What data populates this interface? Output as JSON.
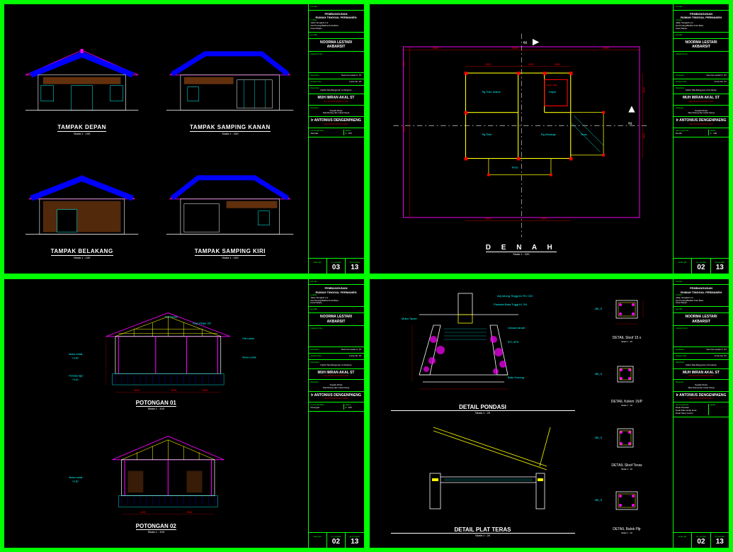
{
  "project": {
    "title_line1": "PEMBANGUNAN",
    "title_line2": "RUMAH TINGGAL PERMANEN",
    "location_label": "Lokasi :",
    "location_1": "Jalan Sungkuh Lor",
    "location_2": "Kel Purangi/Badha Kota Bara",
    "location_3": "Kota Palopo",
    "owner_label": "pemilik",
    "owner_name": "NOORMA LESTARI AKBARSIT",
    "note_label": "catatan/nota :"
  },
  "titleblock": {
    "arsitektur_label": "arsitektur",
    "arsitektur_val": "Noorma Lestari A. ST",
    "drafter_label": "drafterCAD",
    "drafter_val": "Imran Ak. ST",
    "diperiksa_label": "diperiksa",
    "kabid": "Kabid Tata Bangunan & Perijinan",
    "approver_name": "MUH IMRAN AKAL ST",
    "approver_nip": "Nip 19 XXX XXXXX 1 015",
    "disetujui": "disetujui",
    "kepala_dinas": "Kepala Dinas",
    "dinas": "Tata Ruang dan Cipta Karya",
    "kadis_name": "Ir ANTONIUS DENGENPAENG",
    "kadis_nip": "Nip XXXX XXXXX 1 018",
    "nama_gambar": "nama gambar :",
    "skala": "skala :",
    "kode_gbr": "kode gbr",
    "no_lembar": "no. lembar",
    "jml_lembar": "jml lembar",
    "total_sheets": "13"
  },
  "sheet1": {
    "views": [
      {
        "label": "TAMPAK DEPAN",
        "scale": "Skala 1 : 100"
      },
      {
        "label": "TAMPAK SAMPING KANAN",
        "scale": "Skala 1 : 100"
      },
      {
        "label": "TAMPAK BELAKANG",
        "scale": "Skala 1 : 100"
      },
      {
        "label": "TAMPAK SAMPING KIRI",
        "scale": "Skala 1 : 100"
      }
    ],
    "drawing_name": "Tampak",
    "scale": "1 : 100",
    "sheet_no": "03"
  },
  "sheet2": {
    "title": "D E N A H",
    "scale": "Skala 1 : 100",
    "section_marks": {
      "a": "01",
      "b": "02"
    },
    "rooms": [
      "Rg.Tidur Utama",
      "Rg.Keluarga",
      "Rg.Tidur",
      "Teras",
      "Teras",
      "Teras",
      "Dapur",
      "KMC IWC"
    ],
    "drawing_name": "Denah",
    "scale_tb": "1 : 100",
    "sheet_no": "02"
  },
  "sheet3": {
    "views": [
      {
        "label": "POTONGAN 01",
        "scale": "Skala 1 : 100"
      },
      {
        "label": "POTONGAN 02",
        "scale": "Skala 1 : 100"
      }
    ],
    "annotations": [
      "Puit Gantar",
      "Kayu Ringer 2/8",
      "Peil Lantai",
      "Muka Lantai +0.30",
      "Pondasi lajur +0.00",
      "Kuda-kuda",
      "Kusen 105 + 5/6 ant"
    ],
    "drawing_name": "Potongan",
    "scale": "1 : 100",
    "sheet_no": "02"
  },
  "sheet4": {
    "main_details": [
      {
        "label": "DETAIL PONDASI",
        "scale": "Skala 1 : 20"
      },
      {
        "label": "DETAIL PLAT TERAS",
        "scale": "Skala 1 : 20"
      }
    ],
    "side_details": [
      {
        "label": "DETAIL Sloof 15 x",
        "scale": "Skala 1 : 10"
      },
      {
        "label": "DETAIL Kolom 15/P",
        "scale": "Skala 1 : 10"
      },
      {
        "label": "DETAIL Sloof Teras",
        "scale": "Skala 1 : 10"
      },
      {
        "label": "DETAIL Balok Pljr",
        "scale": "Skala 1 : 10"
      }
    ],
    "drawings_list": [
      "Detal Pondasi",
      "Detal Plat Lantai teras",
      "Detal Sloof, Kolom"
    ],
    "sheet_no": "02",
    "anno": [
      "Adj strong Tinggi k1 RC C02",
      "Pasbata Bata Tnggi k1 3/4 orang",
      "spasi tipes 2cm",
      "Urasan tanah IPC 4PS",
      "Batu Kosong",
      "mini 5 cm",
      "Muka Tanah"
    ]
  }
}
